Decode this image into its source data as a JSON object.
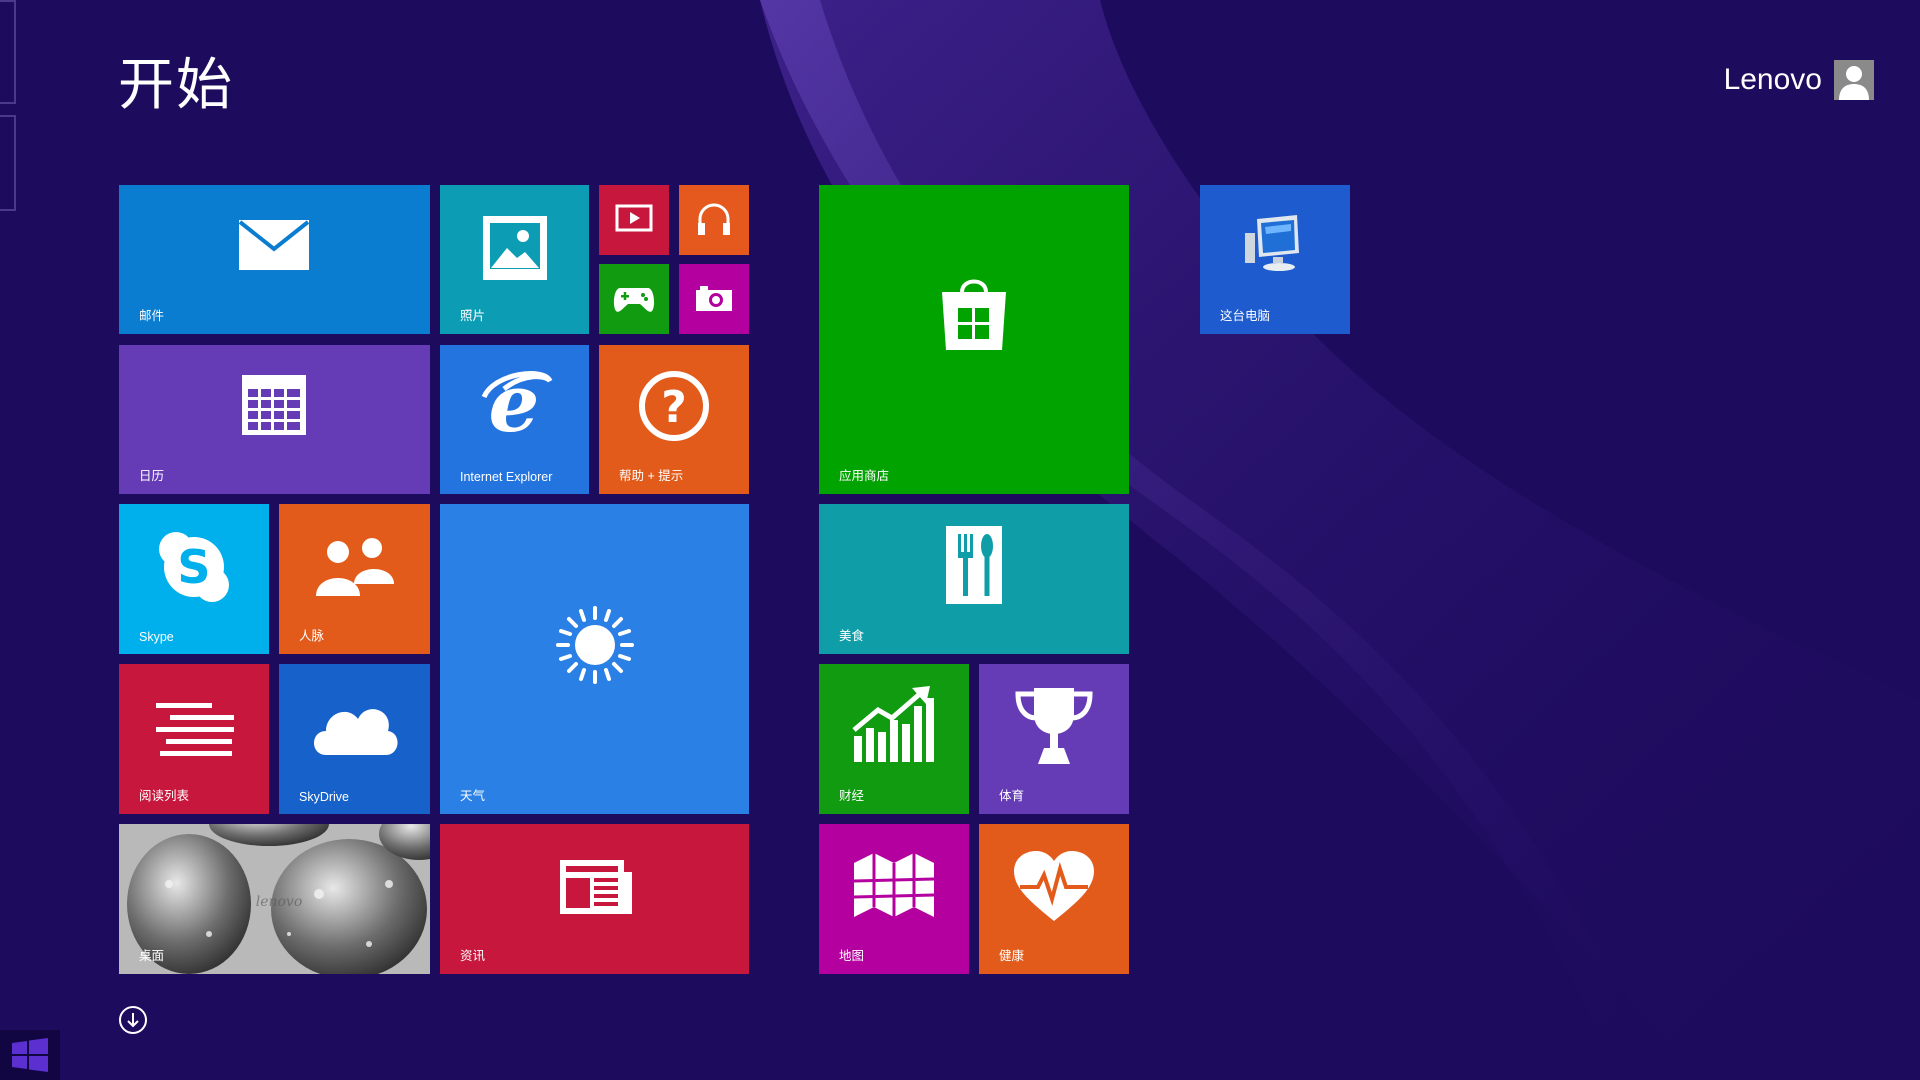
{
  "screen": {
    "title": "开始"
  },
  "user": {
    "name": "Lenovo"
  },
  "colors": {
    "background": "#1d0b5d",
    "mail": "#0a7dd1",
    "photos": "#0c9db4",
    "video": "#c8173c",
    "music": "#e5581e",
    "games": "#109b10",
    "camera": "#b4009e",
    "store": "#00a300",
    "calendar": "#653cb6",
    "ie": "#2474df",
    "help": "#e35b1b",
    "skype": "#00b0ed",
    "people": "#e35b1b",
    "weather": "#2b80e6",
    "food": "#0f9ea8",
    "reading": "#c8173c",
    "skydrive": "#1661ca",
    "finance": "#109b10",
    "sports": "#653cb6",
    "desktop": "#8a8a8a",
    "news": "#c8173c",
    "maps": "#b4009e",
    "health": "#e35b1b",
    "thispc": "#1d5bcf"
  },
  "tiles": {
    "mail": {
      "label": "邮件",
      "icon": "mail-icon"
    },
    "photos": {
      "label": "照片",
      "icon": "photos-icon"
    },
    "video": {
      "label": "",
      "icon": "video-icon"
    },
    "music": {
      "label": "",
      "icon": "headphones-icon"
    },
    "games": {
      "label": "",
      "icon": "gamepad-icon"
    },
    "camera": {
      "label": "",
      "icon": "camera-icon"
    },
    "store": {
      "label": "应用商店",
      "icon": "store-bag-icon"
    },
    "thispc": {
      "label": "这台电脑",
      "icon": "computer-icon"
    },
    "calendar": {
      "label": "日历",
      "icon": "calendar-icon"
    },
    "ie": {
      "label": "Internet Explorer",
      "icon": "ie-icon"
    },
    "help": {
      "label": "帮助 + 提示",
      "icon": "help-icon"
    },
    "skype": {
      "label": "Skype",
      "icon": "skype-icon"
    },
    "people": {
      "label": "人脉",
      "icon": "people-icon"
    },
    "weather": {
      "label": "天气",
      "icon": "sun-icon"
    },
    "food": {
      "label": "美食",
      "icon": "fork-knife-icon"
    },
    "reading": {
      "label": "阅读列表",
      "icon": "reading-list-icon"
    },
    "skydrive": {
      "label": "SkyDrive",
      "icon": "cloud-icon"
    },
    "finance": {
      "label": "财经",
      "icon": "chart-up-icon"
    },
    "sports": {
      "label": "体育",
      "icon": "trophy-icon"
    },
    "desktop": {
      "label": "桌面",
      "icon": "desktop-wallpaper"
    },
    "news": {
      "label": "资讯",
      "icon": "newspaper-icon"
    },
    "maps": {
      "label": "地图",
      "icon": "map-icon"
    },
    "health": {
      "label": "健康",
      "icon": "heart-icon"
    }
  },
  "all_apps": {
    "icon": "arrow-down-circle-icon"
  },
  "taskbar": {
    "icon": "windows-logo-icon"
  }
}
